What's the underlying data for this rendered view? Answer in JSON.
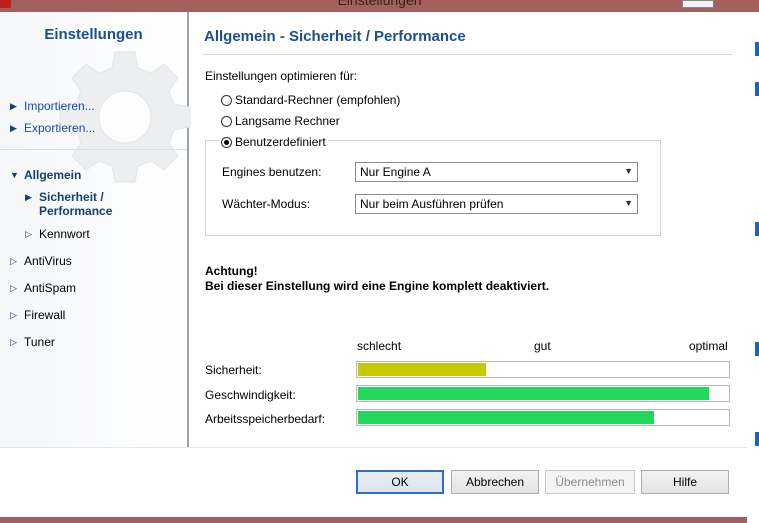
{
  "window": {
    "title": "Einstellungen"
  },
  "sidebar": {
    "title": "Einstellungen",
    "links": [
      {
        "label": "Importieren..."
      },
      {
        "label": "Exportieren..."
      }
    ],
    "items": [
      {
        "label": "Allgemein"
      },
      {
        "label": "Sicherheit / Performance"
      },
      {
        "label": "Kennwort"
      },
      {
        "label": "AntiVirus"
      },
      {
        "label": "AntiSpam"
      },
      {
        "label": "Firewall"
      },
      {
        "label": "Tuner"
      }
    ]
  },
  "main": {
    "title": "Allgemein - Sicherheit / Performance",
    "optimize_label": "Einstellungen optimieren für:",
    "radios": [
      {
        "label": "Standard-Rechner (empfohlen)",
        "selected": false
      },
      {
        "label": "Langsame Rechner",
        "selected": false
      },
      {
        "label": "Benutzerdefiniert",
        "selected": true
      }
    ],
    "engines_label": "Engines benutzen:",
    "engines_value": "Nur Engine A",
    "guard_label": "Wächter-Modus:",
    "guard_value": "Nur beim Ausführen prüfen",
    "warning_title": "Achtung!",
    "warning_text": "Bei dieser Einstellung wird eine Engine komplett deaktiviert.",
    "scale": {
      "low": "schlecht",
      "mid": "gut",
      "high": "optimal"
    },
    "bars": [
      {
        "label": "Sicherheit:",
        "value": 0.35,
        "color": "#c6c800"
      },
      {
        "label": "Geschwindigkeit:",
        "value": 0.95,
        "color": "#22d85a"
      },
      {
        "label": "Arbeitsspeicherbedarf:",
        "value": 0.8,
        "color": "#22d85a"
      }
    ]
  },
  "buttons": {
    "ok": "OK",
    "cancel": "Abbrechen",
    "apply": "Übernehmen",
    "help": "Hilfe"
  }
}
